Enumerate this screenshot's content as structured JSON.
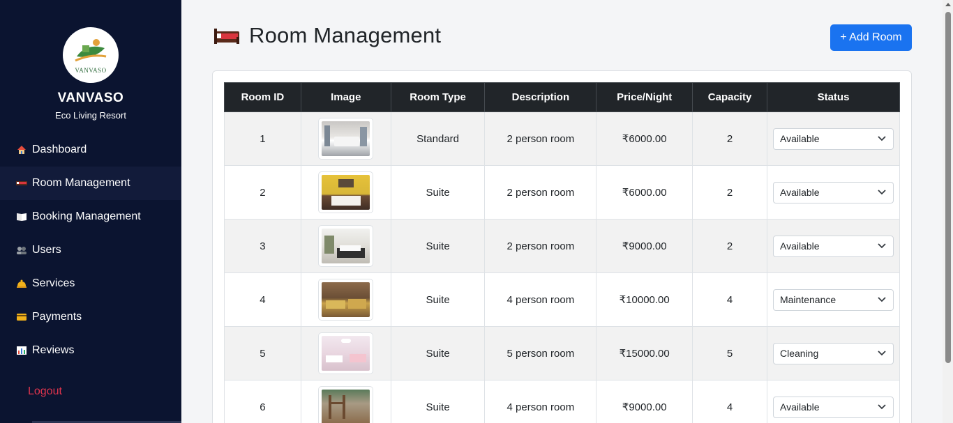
{
  "brand": {
    "logo_text": "VANVASO",
    "name": "VANVASO",
    "subtitle": "Eco Living Resort"
  },
  "nav": [
    {
      "label": "Dashboard",
      "icon": "house-icon"
    },
    {
      "label": "Room Management",
      "icon": "bed-icon"
    },
    {
      "label": "Booking Management",
      "icon": "book-icon"
    },
    {
      "label": "Users",
      "icon": "users-icon"
    },
    {
      "label": "Services",
      "icon": "bell-icon"
    },
    {
      "label": "Payments",
      "icon": "credit-card-icon"
    },
    {
      "label": "Reviews",
      "icon": "bar-chart-icon"
    }
  ],
  "logout": "Logout",
  "header": {
    "title": "Room Management",
    "add_button": "+ Add Room"
  },
  "table": {
    "columns": [
      "Room ID",
      "Image",
      "Room Type",
      "Description",
      "Price/Night",
      "Capacity",
      "Status"
    ],
    "rows": [
      {
        "id": "1",
        "type": "Standard",
        "description": "2 person room",
        "price": "₹6000.00",
        "capacity": "2",
        "status": "Available"
      },
      {
        "id": "2",
        "type": "Suite",
        "description": "2 person room",
        "price": "₹6000.00",
        "capacity": "2",
        "status": "Available"
      },
      {
        "id": "3",
        "type": "Suite",
        "description": "2 person room",
        "price": "₹9000.00",
        "capacity": "2",
        "status": "Available"
      },
      {
        "id": "4",
        "type": "Suite",
        "description": "4 person room",
        "price": "₹10000.00",
        "capacity": "4",
        "status": "Maintenance"
      },
      {
        "id": "5",
        "type": "Suite",
        "description": "5 person room",
        "price": "₹15000.00",
        "capacity": "5",
        "status": "Cleaning"
      },
      {
        "id": "6",
        "type": "Suite",
        "description": "4 person room",
        "price": "₹9000.00",
        "capacity": "4",
        "status": "Available"
      }
    ]
  },
  "colors": {
    "sidebar_bg": "#0b1430",
    "accent": "#1a73f0",
    "logout": "#e0344d",
    "table_header": "#212529"
  }
}
